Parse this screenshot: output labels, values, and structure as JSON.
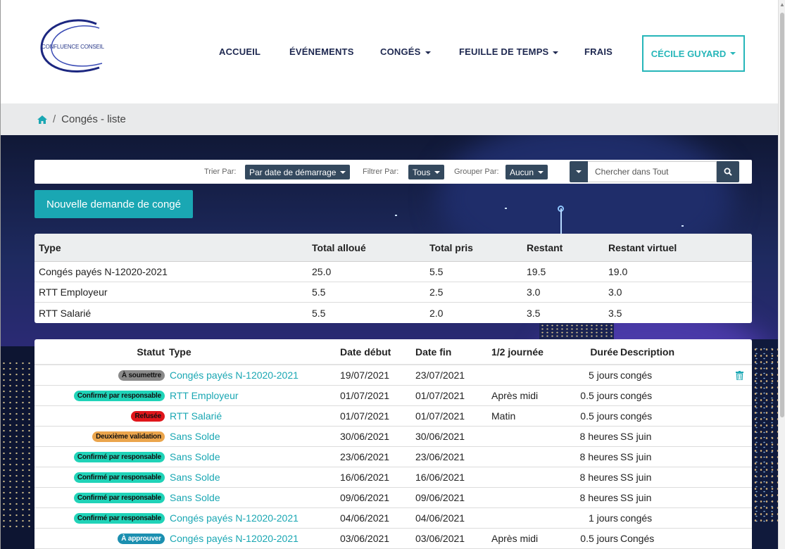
{
  "logo": {
    "text": "CONFLUENCE CONSEIL"
  },
  "nav": {
    "accueil": "ACCUEIL",
    "evenements": "ÉVÉNEMENTS",
    "conges": "CONGÉS",
    "feuille": "FEUILLE DE TEMPS",
    "frais": "FRAIS",
    "user": "CÉCILE GUYARD"
  },
  "breadcrumb": {
    "separator": "/",
    "current": "Congés - liste"
  },
  "toolbar": {
    "sort_label": "Trier Par:",
    "sort_value": "Par date de démarrage",
    "filter_label": "Filtrer Par:",
    "filter_value": "Tous",
    "group_label": "Grouper Par:",
    "group_value": "Aucun",
    "search_placeholder": "Chercher dans Tout"
  },
  "new_request_label": "Nouvelle demande de congé",
  "summary": {
    "headers": [
      "Type",
      "Total alloué",
      "Total pris",
      "Restant",
      "Restant virtuel"
    ],
    "rows": [
      [
        "Congés payés N-12020-2021",
        "25.0",
        "5.5",
        "19.5",
        "19.0"
      ],
      [
        "RTT Employeur",
        "5.5",
        "2.5",
        "3.0",
        "3.0"
      ],
      [
        "RTT Salarié",
        "5.5",
        "2.0",
        "3.5",
        "3.5"
      ]
    ]
  },
  "list": {
    "headers": {
      "statut": "Statut",
      "type": "Type",
      "debut": "Date début",
      "fin": "Date fin",
      "demi": "1/2 journée",
      "duree": "Durée",
      "description": "Description"
    },
    "rows": [
      {
        "statut": "À soumettre",
        "status_color": "#8a8a8a",
        "status_text": "#111111",
        "type": "Congés payés N-12020-2021",
        "debut": "19/07/2021",
        "fin": "23/07/2021",
        "demi": "",
        "duree": "5 jours",
        "description": "congés"
      },
      {
        "statut": "Confirmé par responsable",
        "status_color": "#20d3b8",
        "status_text": "#111111",
        "type": "RTT Employeur",
        "debut": "01/07/2021",
        "fin": "01/07/2021",
        "demi": "Après midi",
        "duree": "0.5 jours",
        "description": "congés"
      },
      {
        "statut": "Refusée",
        "status_color": "#e0161b",
        "status_text": "#111111",
        "type": "RTT Salarié",
        "debut": "01/07/2021",
        "fin": "01/07/2021",
        "demi": "Matin",
        "duree": "0.5 jours",
        "description": "congés"
      },
      {
        "statut": "Deuxième validation",
        "status_color": "#eba54c",
        "status_text": "#111111",
        "type": "Sans Solde",
        "debut": "30/06/2021",
        "fin": "30/06/2021",
        "demi": "",
        "duree": "8 heures",
        "description": "SS juin"
      },
      {
        "statut": "Confirmé par responsable",
        "status_color": "#20d3b8",
        "status_text": "#111111",
        "type": "Sans Solde",
        "debut": "23/06/2021",
        "fin": "23/06/2021",
        "demi": "",
        "duree": "8 heures",
        "description": "SS juin"
      },
      {
        "statut": "Confirmé par responsable",
        "status_color": "#20d3b8",
        "status_text": "#111111",
        "type": "Sans Solde",
        "debut": "16/06/2021",
        "fin": "16/06/2021",
        "demi": "",
        "duree": "8 heures",
        "description": "SS juin"
      },
      {
        "statut": "Confirmé par responsable",
        "status_color": "#20d3b8",
        "status_text": "#111111",
        "type": "Sans Solde",
        "debut": "09/06/2021",
        "fin": "09/06/2021",
        "demi": "",
        "duree": "8 heures",
        "description": "SS juin"
      },
      {
        "statut": "Confirmé par responsable",
        "status_color": "#20d3b8",
        "status_text": "#111111",
        "type": "Congés payés N-12020-2021",
        "debut": "04/06/2021",
        "fin": "04/06/2021",
        "demi": "",
        "duree": "1 jours",
        "description": "congés"
      },
      {
        "statut": "À approuver",
        "status_color": "#1b8fb0",
        "status_text": "#ffffff",
        "type": "Congés payés N-12020-2021",
        "debut": "03/06/2021",
        "fin": "03/06/2021",
        "demi": "Après midi",
        "duree": "0.5 jours",
        "description": "Congés"
      }
    ]
  },
  "colors": {
    "accent": "#1aa7b3",
    "dark": "#34495e",
    "nav_text": "#1e2850"
  },
  "icons": {
    "home": "home-icon",
    "search": "search-icon",
    "trash": "trash-icon",
    "caret": "caret-down-icon"
  }
}
